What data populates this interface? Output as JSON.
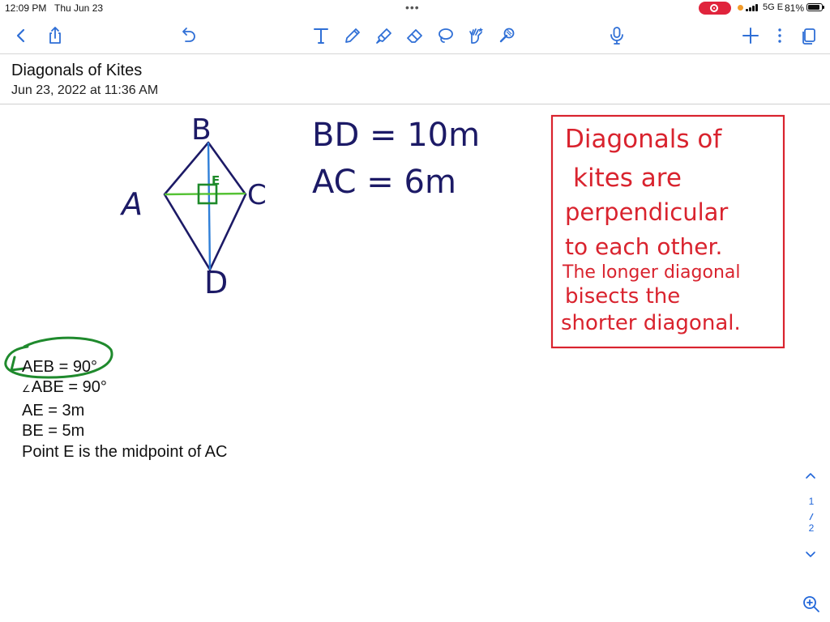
{
  "status_bar": {
    "time": "12:09 PM",
    "date": "Thu Jun 23",
    "network": "5G E",
    "battery": "81%"
  },
  "toolbar": {
    "accent_color": "#2f6fd6",
    "left_icons": [
      "back-chevron-icon",
      "share-icon",
      "undo-icon"
    ],
    "tool_icons": [
      "text-tool-icon",
      "pen-icon",
      "highlighter-icon",
      "eraser-icon",
      "lasso-icon",
      "shape-hand-icon",
      "laser-pointer-icon"
    ],
    "right_icons": [
      "microphone-icon",
      "add-icon",
      "more-icon",
      "pages-icon"
    ]
  },
  "note": {
    "title": "Diagonals of Kites",
    "date": "Jun 23, 2022 at 11:36 AM"
  },
  "handwriting": {
    "labels": {
      "b": "B",
      "a": "A",
      "c": "C",
      "d": "D",
      "e": "E"
    },
    "bd": "BD = 10m",
    "ac": "AC = 6m",
    "note_lines": [
      "Diagonals of",
      "kites are",
      "perpendicular",
      "to each other.",
      "The longer diagonal",
      "bisects the",
      "shorter diagonal."
    ],
    "colors": {
      "ink_navy": "#1c1a66",
      "diagonal_blue": "#2f7fd8",
      "diagonal_green": "#55c234",
      "right_angle_green": "#1e8a2a",
      "circle_green": "#1f8a2d",
      "note_red": "#d9232e"
    }
  },
  "typed_lines": {
    "aeb_text": "AEB = 90°",
    "abe_angle": "∠",
    "abe_text": "ABE = 90°",
    "ae": "AE = 3m",
    "be": "BE = 5m",
    "midpoint": "Point E is the midpoint of AC"
  },
  "page_nav": {
    "current": "1",
    "total": "2"
  }
}
